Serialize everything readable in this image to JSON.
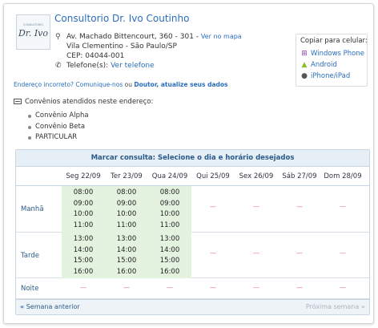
{
  "doctor": {
    "logo_small": "CONSULTORIO",
    "logo_script": "Dr. Ivo",
    "name": "Consultorio Dr. Ivo Coutinho"
  },
  "address": {
    "street": "Av. Machado Bittencourt, 360 - 301 -",
    "map_link": "Ver no mapa",
    "city": "Vila Clementino - São Paulo/SP",
    "cep": "CEP: 04044-001",
    "phone_label": "Telefone(s):",
    "phone_link": "Ver telefone"
  },
  "copy": {
    "header": "Copiar para celular:",
    "options": [
      {
        "label": "Windows Phone",
        "icon": "windows-icon",
        "color": "#8b3fb0"
      },
      {
        "label": "Android",
        "icon": "android-icon",
        "color": "#8cbf26"
      },
      {
        "label": "iPhone/iPad",
        "icon": "apple-icon",
        "color": "#555555"
      }
    ]
  },
  "report": {
    "link": "Endereço incorreto? Comunique-nos",
    "middle": "ou",
    "bold_link": "Doutor, atualize seus dados"
  },
  "convenios": {
    "title": "Convênios atendidos neste endereço:",
    "items": [
      "Convênio Alpha",
      "Convênio Beta",
      "PARTICULAR"
    ]
  },
  "schedule": {
    "title": "Marcar consulta: Selecione o dia e horário desejados",
    "days": [
      "Seg 22/09",
      "Ter 23/09",
      "Qua 24/09",
      "Qui 25/09",
      "Sex 26/09",
      "Sáb 27/09",
      "Dom 28/09"
    ],
    "periods": [
      {
        "label": "Manhã",
        "slots": [
          [
            "08:00",
            "09:00",
            "10:00",
            "11:00"
          ],
          [
            "08:00",
            "09:00",
            "10:00",
            "11:00"
          ],
          [
            "08:00",
            "09:00",
            "10:00",
            "11:00"
          ],
          [],
          [],
          [],
          []
        ]
      },
      {
        "label": "Tarde",
        "slots": [
          [
            "13:00",
            "14:00",
            "15:00",
            "16:00"
          ],
          [
            "13:00",
            "14:00",
            "15:00",
            "16:00"
          ],
          [
            "13:00",
            "14:00",
            "15:00",
            "16:00"
          ],
          [],
          [],
          [],
          []
        ]
      },
      {
        "label": "Noite",
        "slots": [
          [],
          [],
          [],
          [],
          [],
          [],
          []
        ]
      }
    ],
    "empty_marker": "—",
    "prev_label": "Semana anterior",
    "next_label": "Próxima semana"
  },
  "colors": {
    "link": "#2a6ebb",
    "available_bg": "#e4f2e0",
    "empty_marker": "#e07070",
    "header_bg": "#e6eef6"
  }
}
